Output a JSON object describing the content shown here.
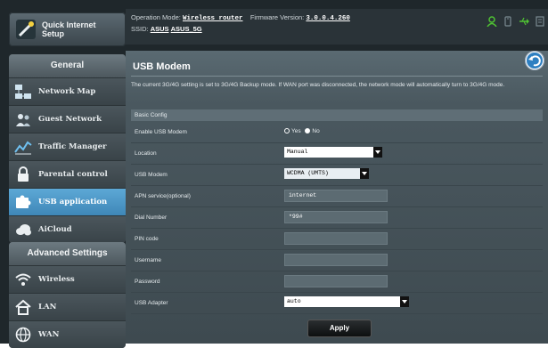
{
  "quick_internet_setup": {
    "label_line1": "Quick Internet",
    "label_line2": "Setup"
  },
  "general": {
    "title": "General",
    "items": [
      {
        "label": "Network Map",
        "icon": "network-map-icon"
      },
      {
        "label": "Guest Network",
        "icon": "guest-network-icon"
      },
      {
        "label": "Traffic Manager",
        "icon": "traffic-manager-icon"
      },
      {
        "label": "Parental control",
        "icon": "lock-icon"
      },
      {
        "label": "USB application",
        "icon": "puzzle-icon",
        "active": true
      },
      {
        "label": "AiCloud",
        "icon": "cloud-icon"
      }
    ]
  },
  "advanced": {
    "title": "Advanced Settings",
    "items": [
      {
        "label": "Wireless",
        "icon": "wifi-icon"
      },
      {
        "label": "LAN",
        "icon": "home-icon"
      },
      {
        "label": "WAN",
        "icon": "globe-icon"
      }
    ]
  },
  "topbar": {
    "op_mode_label": "Operation Mode:",
    "op_mode_value": "Wireless router",
    "fw_label": "Firmware Version:",
    "fw_value": "3.0.0.4.260",
    "ssid_label": "SSID:",
    "ssid_1": "ASUS",
    "ssid_2": "ASUS_5G"
  },
  "page": {
    "title": "USB Modem",
    "description": "The current 3G/4G setting is set to 3G/4G Backup mode. If WAN port was disconnected, the network mode will automatically turn to 3G/4G mode.",
    "section": "Basic Config",
    "apply_label": "Apply"
  },
  "form": {
    "enable": {
      "label": "Enable USB Modem",
      "yes": "Yes",
      "no": "No",
      "selected": "No"
    },
    "location": {
      "label": "Location",
      "value": "Manual"
    },
    "usb_modem": {
      "label": "USB Modem",
      "value": "WCDMA (UMTS)"
    },
    "apn": {
      "label": "APN service(optional)",
      "value": "internet"
    },
    "dial": {
      "label": "Dial Number",
      "value": "*99#"
    },
    "pin": {
      "label": "PIN code",
      "value": ""
    },
    "username": {
      "label": "Username",
      "value": ""
    },
    "password": {
      "label": "Password",
      "value": ""
    },
    "adapter": {
      "label": "USB Adapter",
      "value": "auto"
    }
  },
  "colors": {
    "active_item": "#3f87b8",
    "accent_blue": "#2d7fc1",
    "status_green": "#4fc233"
  }
}
